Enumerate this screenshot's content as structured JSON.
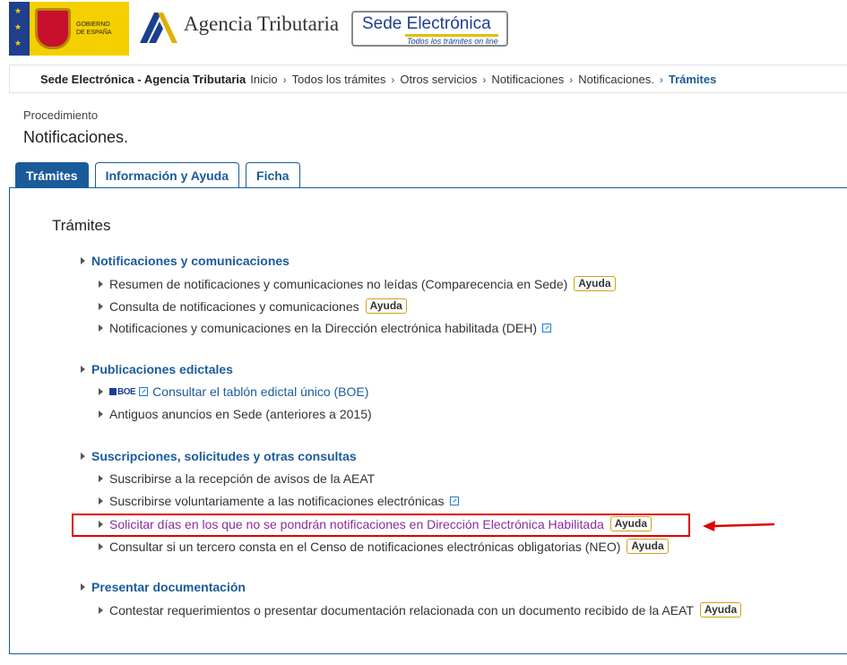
{
  "header": {
    "gobierno_text": [
      "GOBIERNO",
      "DE ESPAÑA"
    ],
    "agency_name": "Agencia Tributaria",
    "sede_title": "Sede Electrónica",
    "sede_subtitle": "Todos los trámites on line"
  },
  "breadcrumb": {
    "site": "Sede Electrónica - Agencia Tributaria",
    "items": [
      "Inicio",
      "Todos los trámites",
      "Otros servicios",
      "Notificaciones",
      "Notificaciones.",
      "Trámites"
    ]
  },
  "procedure": {
    "label": "Procedimiento",
    "title": "Notificaciones."
  },
  "tabs": [
    "Trámites",
    "Información y Ayuda",
    "Ficha"
  ],
  "panel": {
    "title": "Trámites",
    "ayuda_label": "Ayuda",
    "sections": [
      {
        "title": "Notificaciones y comunicaciones",
        "items": [
          "Resumen de notificaciones y comunicaciones no leídas (Comparecencia en Sede)",
          "Consulta de notificaciones y comunicaciones",
          "Notificaciones y comunicaciones en la Dirección electrónica habilitada (DEH)"
        ]
      },
      {
        "title": "Publicaciones edictales",
        "items": [
          "Consultar el tablón edictal único (BOE)",
          "Antiguos anuncios en Sede (anteriores a 2015)"
        ]
      },
      {
        "title": "Suscripciones, solicitudes y otras consultas",
        "items": [
          "Suscribirse a la recepción de avisos de la AEAT",
          "Suscribirse voluntariamente a las notificaciones electrónicas",
          "Solicitar días en los que no se pondrán notificaciones en Dirección Electrónica Habilitada",
          "Consultar si un tercero consta en el Censo de notificaciones electrónicas obligatorias (NEO)"
        ]
      },
      {
        "title": "Presentar documentación",
        "items": [
          "Contestar requerimientos o presentar documentación relacionada con un documento recibido de la AEAT"
        ]
      }
    ]
  },
  "boe_logo": "BOE",
  "colors": {
    "primary_blue": "#1a5b9a",
    "visited_purple": "#8a2c9e",
    "highlight_red": "#e00000",
    "ayuda_border": "#d4a017"
  }
}
